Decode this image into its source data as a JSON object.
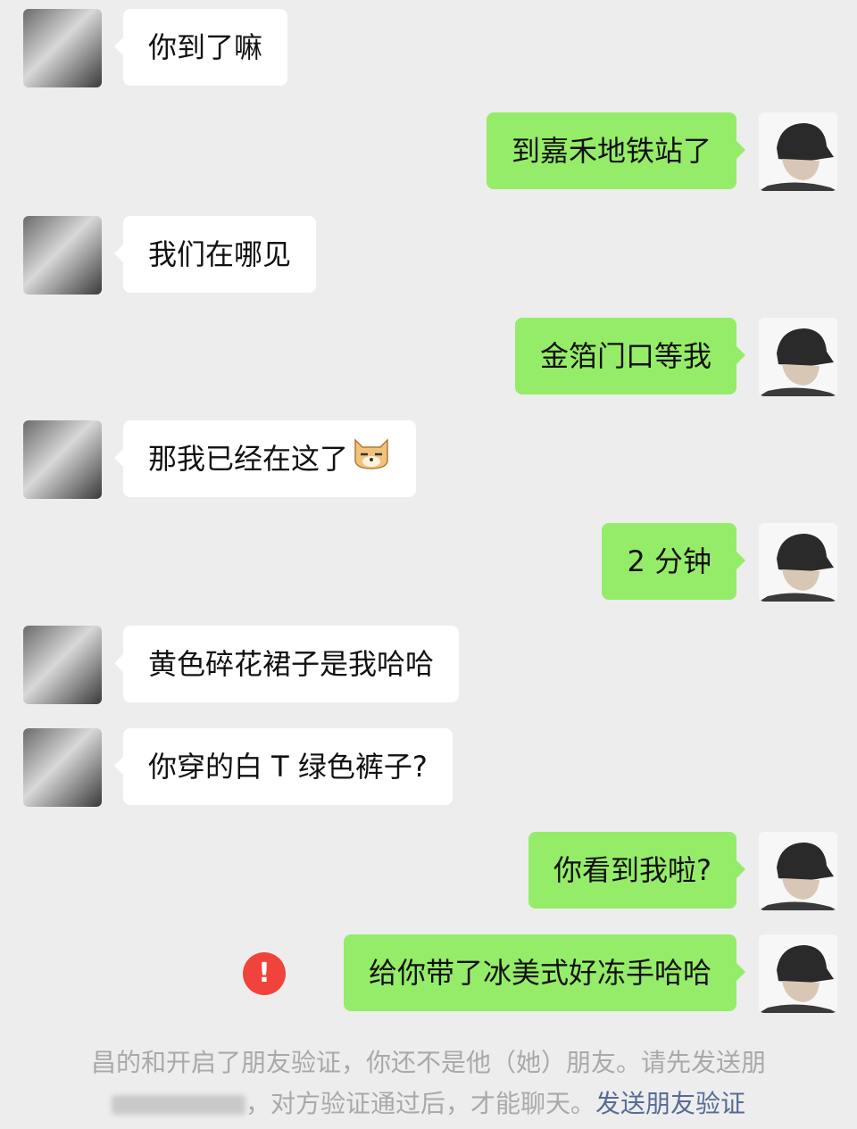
{
  "colors": {
    "background": "#ededed",
    "incoming_bubble": "#ffffff",
    "outgoing_bubble": "#95ec69",
    "error": "#f0433c",
    "link": "#576b95",
    "system_text": "#a9a9a9"
  },
  "messages": [
    {
      "side": "in",
      "text": "你到了嘛"
    },
    {
      "side": "out",
      "text": "到嘉禾地铁站了"
    },
    {
      "side": "in",
      "text": "我们在哪见"
    },
    {
      "side": "out",
      "text": "金箔门口等我"
    },
    {
      "side": "in",
      "text": "那我已经在这了",
      "emoji": "doge-emoji"
    },
    {
      "side": "out",
      "text": "2 分钟"
    },
    {
      "side": "in",
      "text": "黄色碎花裙子是我哈哈"
    },
    {
      "side": "in",
      "text": "你穿的白 T 绿色裤子?"
    },
    {
      "side": "out",
      "text": "你看到我啦?"
    },
    {
      "side": "out",
      "text": "给你带了冰美式好冻手哈哈",
      "status": "failed"
    }
  ],
  "fail_icon": "!",
  "system_notice": {
    "line1": "昌的和开启了朋友验证，你还不是他（她）朋友。请先发送朋",
    "line2_mid": "，对方验证通过后，才能聊天。",
    "link_text": "发送朋友验证"
  }
}
